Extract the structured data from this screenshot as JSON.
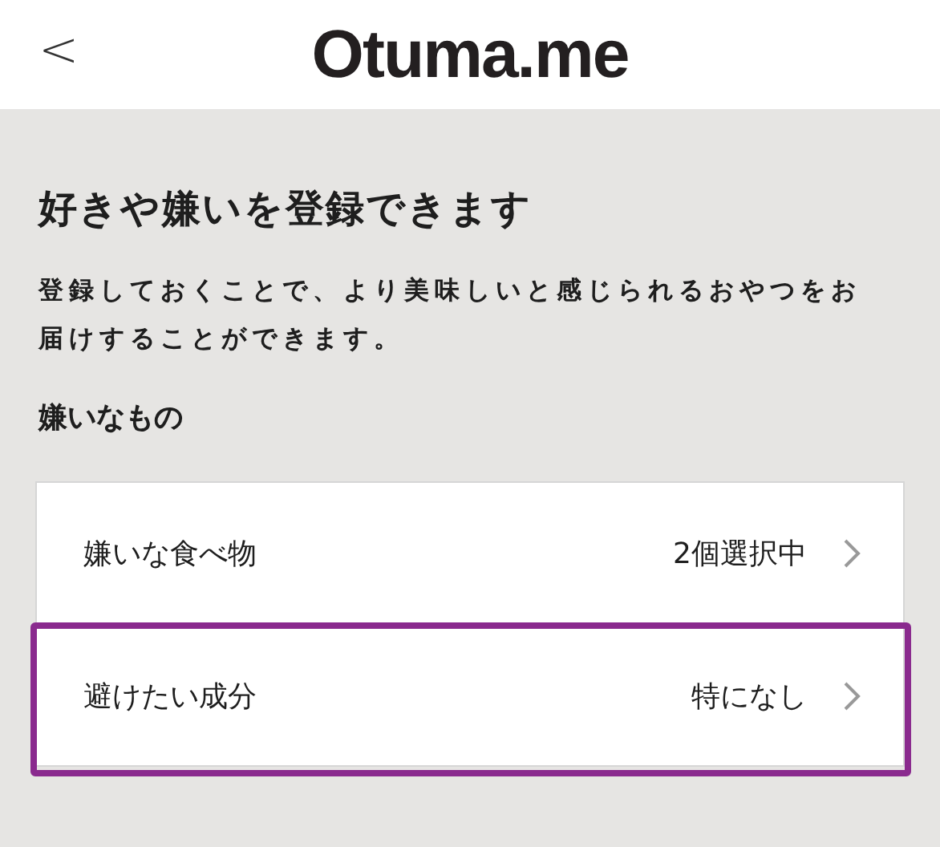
{
  "header": {
    "back": "<",
    "logo": "Otuma.me"
  },
  "title": "好きや嫌いを登録できます",
  "description": "登録しておくことで、より美味しいと感じられるおやつをお届けすることができます。",
  "section": "嫌いなもの",
  "rows": [
    {
      "label": "嫌いな食べ物",
      "value": "2個選択中",
      "highlighted": false
    },
    {
      "label": "避けたい成分",
      "value": "特になし",
      "highlighted": true
    }
  ]
}
